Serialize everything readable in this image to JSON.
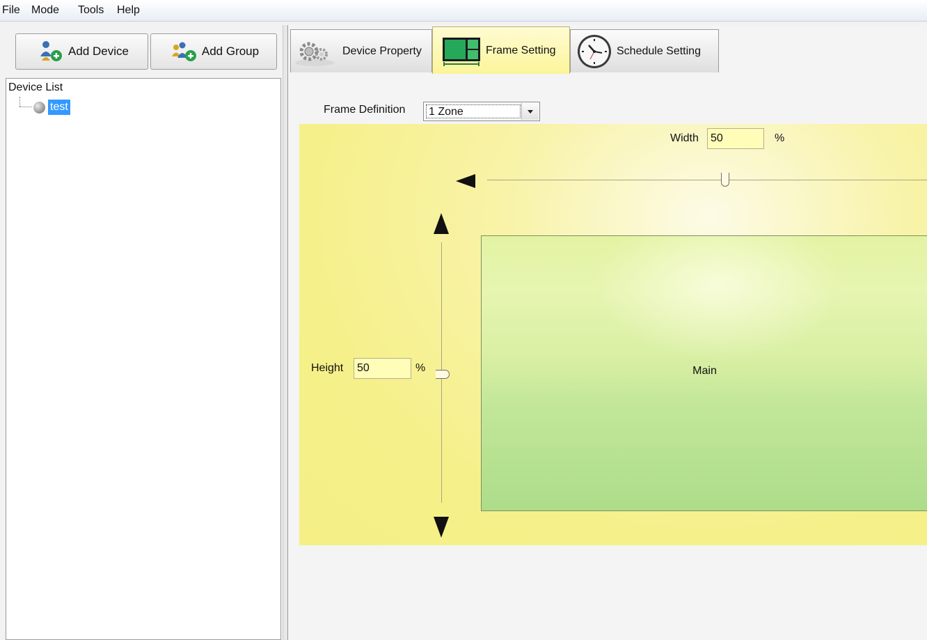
{
  "menu": [
    "File",
    "Mode",
    "Tools",
    "Help"
  ],
  "toolbar": {
    "add_device": "Add Device",
    "add_group": "Add Group"
  },
  "device_list": {
    "title": "Device List",
    "devices": [
      "test"
    ]
  },
  "tabs": [
    {
      "label": "Device Property",
      "icon": "gears-icon",
      "active": false
    },
    {
      "label": "Frame Setting",
      "icon": "frame-layout-icon",
      "active": true
    },
    {
      "label": "Schedule Setting",
      "icon": "clock-icon",
      "active": false
    }
  ],
  "frame_setting": {
    "frame_definition_label": "Frame Definition",
    "frame_definition_value": "1 Zone",
    "width_label": "Width",
    "width_value": "50",
    "width_unit": "%",
    "height_label": "Height",
    "height_value": "50",
    "height_unit": "%",
    "zone_label": "Main",
    "width_slider_fraction": 0.5,
    "height_slider_fraction": 0.5
  },
  "colors": {
    "accent_selection": "#3399ff",
    "preview_bg": "#f6f08a",
    "zone_fill": "#c4e79a"
  }
}
